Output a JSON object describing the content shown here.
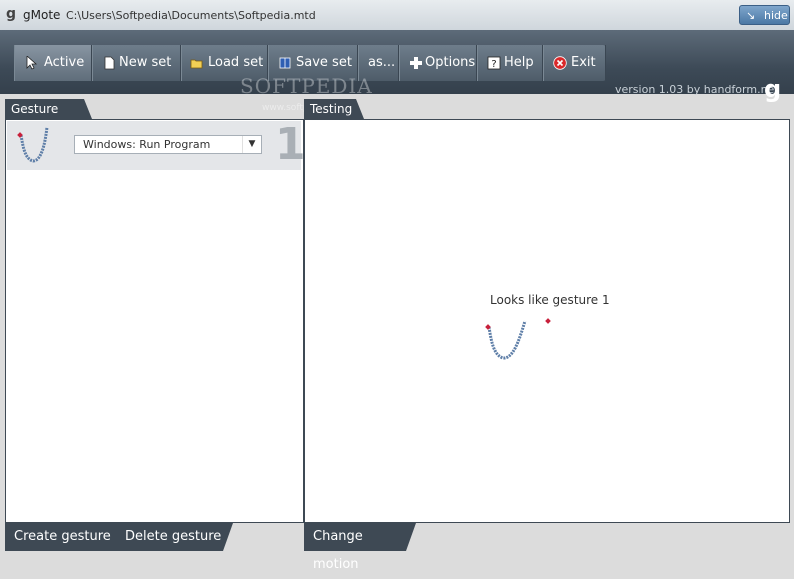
{
  "window": {
    "app_name": "gMote",
    "file_path": "C:\\Users\\Softpedia\\Documents\\Softpedia.mtd",
    "hide_label": "hide"
  },
  "toolbar": {
    "buttons": [
      {
        "label": "Active",
        "icon": "cursor-icon"
      },
      {
        "label": "New set",
        "icon": "document-icon"
      },
      {
        "label": "Load set",
        "icon": "folder-open-icon"
      },
      {
        "label": "Save set",
        "icon": "book-icon"
      },
      {
        "label": "as...",
        "icon": ""
      },
      {
        "label": "Options",
        "icon": "plus-icon"
      },
      {
        "label": "Help",
        "icon": "help-icon"
      },
      {
        "label": "Exit",
        "icon": "exit-icon"
      }
    ],
    "version": "version 1.03 by handform.net",
    "watermark": "SOFTPEDIA",
    "watermark_url": "www.softpedia.com"
  },
  "gesture_set": {
    "tab_label": "Gesture set",
    "items": [
      {
        "number": "1",
        "action": "Windows: Run Program"
      }
    ],
    "create_label": "Create gesture",
    "delete_label": "Delete gesture"
  },
  "testing": {
    "tab_label": "Testing",
    "message": "Looks like gesture 1",
    "change_motion_label": "Change motion"
  },
  "colors": {
    "toolbar": "#3d4a57",
    "panel_border": "#3e4954",
    "exit_red": "#d9282a"
  }
}
